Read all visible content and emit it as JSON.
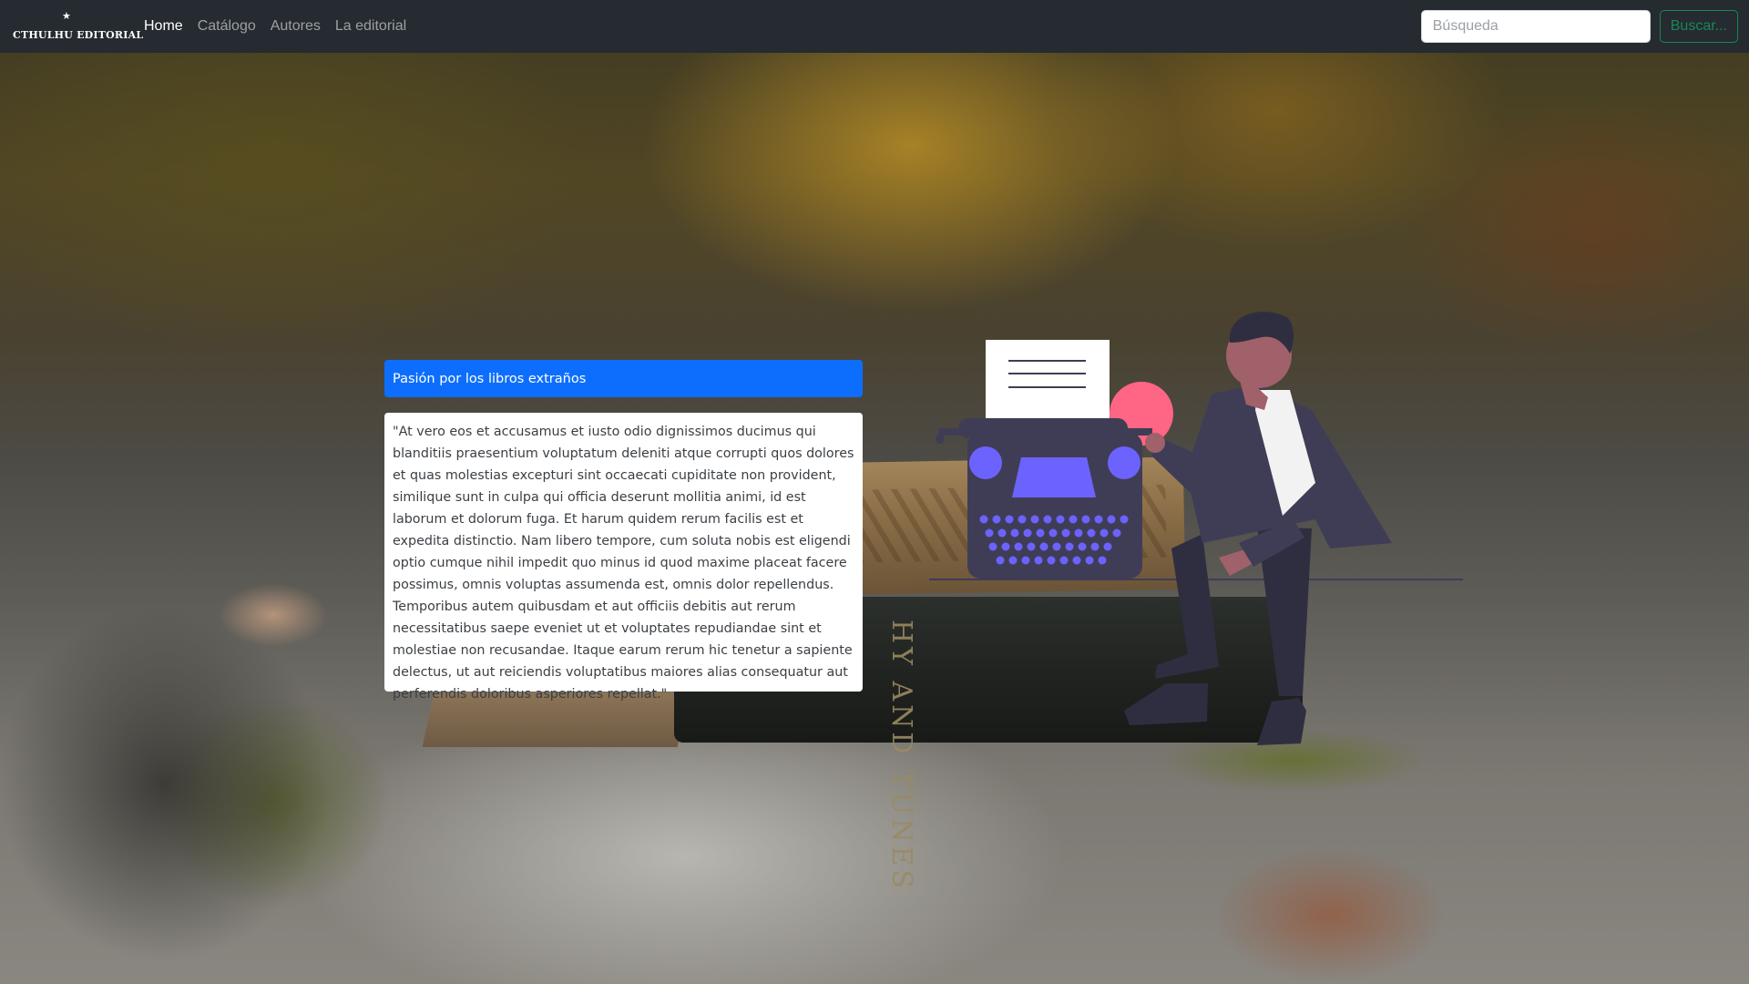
{
  "navbar": {
    "brand": "CTHULHU EDITORIAL",
    "links": [
      {
        "label": "Home",
        "active": true
      },
      {
        "label": "Catálogo",
        "active": false
      },
      {
        "label": "Autores",
        "active": false
      },
      {
        "label": "La editorial",
        "active": false
      }
    ],
    "search": {
      "placeholder": "Búsqueda",
      "button_label": "Buscar..."
    }
  },
  "hero": {
    "headline": "Pasión por los libros extraños",
    "quote": "\"At vero eos et accusamus et iusto odio dignissimos ducimus qui blanditiis praesentium voluptatum deleniti atque corrupti quos dolores et quas molestias excepturi sint occaecati cupiditate non provident, similique sunt in culpa qui officia deserunt mollitia animi, id est laborum et dolorum fuga. Et harum quidem rerum facilis est et expedita distinctio. Nam libero tempore, cum soluta nobis est eligendi optio cumque nihil impedit quo minus id quod maxime placeat facere possimus, omnis voluptas assumenda est, omnis dolor repellendus. Temporibus autem quibusdam et aut officiis debitis aut rerum necessitatibus saepe eveniet ut et voluptates repudiandae sint et molestiae non recusandae. Itaque earum rerum hic tenetur a sapiente delectus, ut aut reiciendis voluptatibus maiores alias consequatur aut perferendis doloribus asperiores repellat.\""
  },
  "background": {
    "book_spine_text": "HY AND TUNES"
  },
  "colors": {
    "navbar_bg": "#252b30",
    "primary": "#0d6efd",
    "success": "#198754",
    "typewriter": "#3f3d56",
    "typewriter_accent": "#6c63ff",
    "circle_accent": "#ff6584"
  }
}
